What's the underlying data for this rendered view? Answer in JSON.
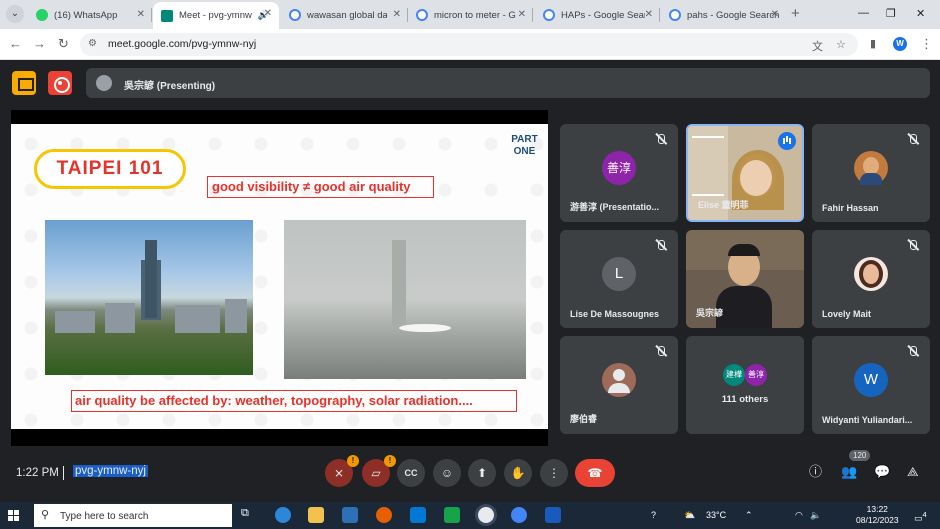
{
  "browser": {
    "tabs": [
      {
        "label": "(16) WhatsApp",
        "color": "#25d366"
      },
      {
        "label": "Meet - pvg-ymnw",
        "color": "#00897b",
        "active": true
      },
      {
        "label": "wawasan global data",
        "color": "#4285f4"
      },
      {
        "label": "micron to meter - Go",
        "color": "#4285f4"
      },
      {
        "label": "HAPs - Google Search",
        "color": "#4285f4"
      },
      {
        "label": "pahs - Google Search",
        "color": "#4285f4"
      }
    ],
    "url": "meet.google.com/pvg-ymnw-nyj",
    "profile_initial": "W"
  },
  "meet": {
    "presenter_label": "吳宗諺 (Presenting)",
    "slide": {
      "title": "TAIPEI 101",
      "part": "PART ONE",
      "visibility_text": "good visibility ≠ good air quality",
      "affect_text": "air quality be affected by: weather, topography, solar radiation...."
    },
    "participants": [
      {
        "name": "游善淳 (Presentatio...",
        "initials": "善淳",
        "color": "#8e24aa",
        "muted": true
      },
      {
        "name": "Elise 童明菲",
        "video": true,
        "speaking": true
      },
      {
        "name": "Fahir Hassan",
        "photo": true,
        "muted": true
      },
      {
        "name": "Lise De Massougnes",
        "initials": "L",
        "color": "#5f6368",
        "muted": true
      },
      {
        "name": "吳宗諺",
        "video": true
      },
      {
        "name": "Lovely Mait",
        "photo": true,
        "muted": true
      },
      {
        "name": "廖伯睿",
        "photo": true,
        "muted": true
      },
      {
        "name": "111 others",
        "others": [
          "建樺",
          "善淳"
        ]
      },
      {
        "name": "Widyanti Yuliandari...",
        "initials": "W",
        "color": "#1565c0",
        "muted": true
      }
    ],
    "time": "1:22 PM",
    "meeting_code": "pvg-ymnw-nyj",
    "people_count": "120"
  },
  "taskbar": {
    "search_placeholder": "Type here to search",
    "temperature": "33°C",
    "time": "13:22",
    "date": "08/12/2023",
    "notifications": "4"
  }
}
